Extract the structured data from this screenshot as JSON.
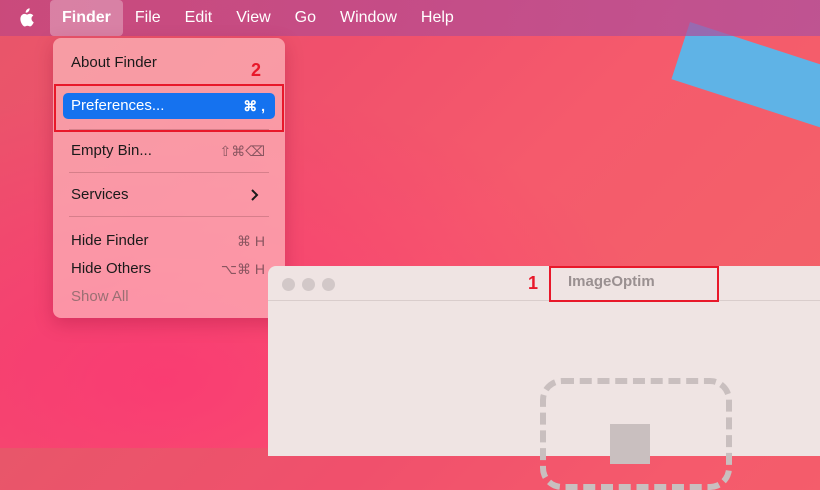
{
  "menubar": {
    "apple_icon": "apple-logo-icon",
    "items": [
      "Finder",
      "File",
      "Edit",
      "View",
      "Go",
      "Window",
      "Help"
    ]
  },
  "finder_menu": {
    "about": "About Finder",
    "preferences": "Preferences...",
    "preferences_shortcut": "⌘ ,",
    "empty_bin": "Empty Bin...",
    "empty_bin_shortcut": "⇧⌘⌫",
    "services": "Services",
    "hide_finder": "Hide Finder",
    "hide_finder_shortcut": "⌘ H",
    "hide_others": "Hide Others",
    "hide_others_shortcut": "⌥⌘ H",
    "show_all": "Show All"
  },
  "annotations": {
    "step1": "1",
    "step2": "2"
  },
  "window": {
    "title": "ImageOptim"
  },
  "colors": {
    "highlight": "#1572ef",
    "annotation": "#e8182a"
  }
}
